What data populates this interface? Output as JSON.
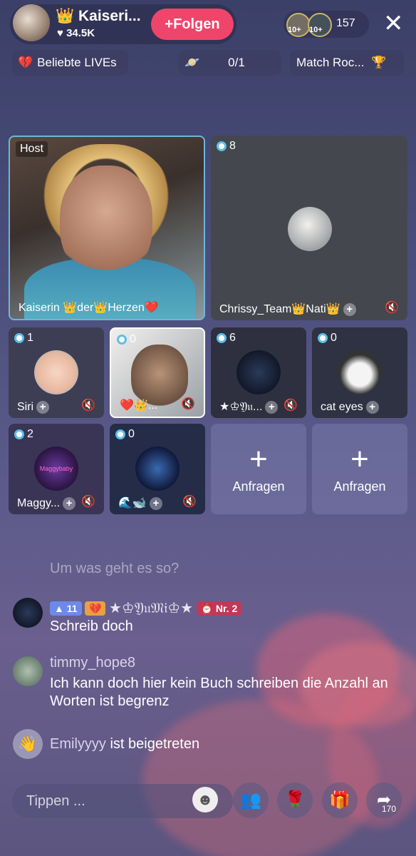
{
  "header": {
    "host_name": "Kaiseri...",
    "likes": "34.5K",
    "follow_label": "Folgen",
    "viewer_badges": [
      "10+",
      "10+"
    ],
    "viewer_count": "157"
  },
  "row2": {
    "popular_label": "Beliebte LIVEs",
    "progress": "0/1",
    "match_label": "Match Roc..."
  },
  "grid": {
    "host_tag": "Host",
    "host_name": "Kaiserin 👑der👑Herzen❤️",
    "guest1": {
      "count": "8",
      "name": "Chrissy_Team👑Nati👑"
    },
    "slots": [
      {
        "count": "1",
        "name": "Siri"
      },
      {
        "count": "0",
        "name": "❤️👑..."
      },
      {
        "count": "6",
        "name": "★♔𝔜𝔲..."
      },
      {
        "count": "0",
        "name": "cat eyes"
      },
      {
        "count": "2",
        "name": "Maggy..."
      },
      {
        "count": "0",
        "name": "🌊🐋"
      }
    ],
    "request_label": "Anfragen",
    "avatar_text_maggy": "Maggybaby"
  },
  "chat": {
    "faded_message": "Um was geht es so?",
    "msg1": {
      "level": "11",
      "heart_badge": "💔",
      "user": "★♔𝔜𝔲𝔐𝔦♔★",
      "rank": "Nr. 2",
      "text": "Schreib doch"
    },
    "msg2": {
      "user": "timmy_hope8",
      "text": "Ich kann doch hier kein Buch schreiben die Anzahl an Worten ist begrenz"
    },
    "join": {
      "user": "Emilyyyy",
      "text": "ist beigetreten"
    }
  },
  "bottom": {
    "input_placeholder": "Tippen ...",
    "share_count": "170"
  }
}
